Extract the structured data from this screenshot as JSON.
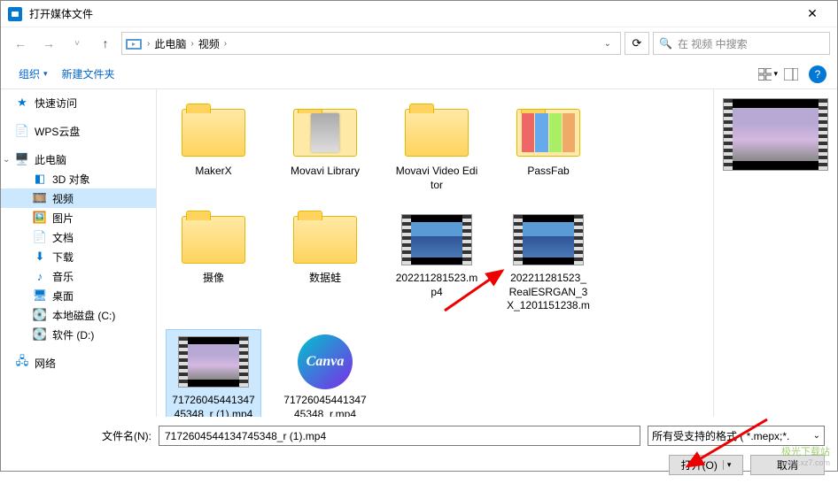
{
  "window": {
    "title": "打开媒体文件"
  },
  "nav": {
    "breadcrumb": {
      "root": "此电脑",
      "folder": "视频"
    },
    "search_placeholder": "在 视频 中搜索"
  },
  "toolbar": {
    "organize": "组织",
    "new_folder": "新建文件夹"
  },
  "sidebar": {
    "quick_access": "快速访问",
    "wps_cloud": "WPS云盘",
    "this_pc": "此电脑",
    "objects_3d": "3D 对象",
    "videos": "视频",
    "pictures": "图片",
    "documents": "文档",
    "downloads": "下载",
    "music": "音乐",
    "desktop": "桌面",
    "local_c": "本地磁盘 (C:)",
    "soft_d": "软件 (D:)",
    "network": "网络"
  },
  "files": [
    {
      "name": "MakerX",
      "type": "folder"
    },
    {
      "name": "Movavi Library",
      "type": "folder-thumb"
    },
    {
      "name": "Movavi Video Editor",
      "type": "folder"
    },
    {
      "name": "PassFab",
      "type": "folder-multi"
    },
    {
      "name": "摄像",
      "type": "folder"
    },
    {
      "name": "数据蛙",
      "type": "folder"
    },
    {
      "name": "202211281523.mp4",
      "type": "video1"
    },
    {
      "name": "202211281523_RealESRGAN_3X_1201151238.mp4",
      "type": "video1"
    },
    {
      "name": "7172604544134745348_r (1).mp4",
      "type": "video2",
      "selected": true
    },
    {
      "name": "7172604544134745348_r.mp4",
      "type": "canva"
    }
  ],
  "bottom": {
    "filename_label": "文件名(N):",
    "filename_value": "7172604544134745348_r (1).mp4",
    "filter": "所有受支持的格式 ( *.mepx;*.",
    "open": "打开(O)",
    "cancel": "取消"
  },
  "watermark": {
    "main": "极光下载站",
    "sub": "www.xz7.com"
  }
}
